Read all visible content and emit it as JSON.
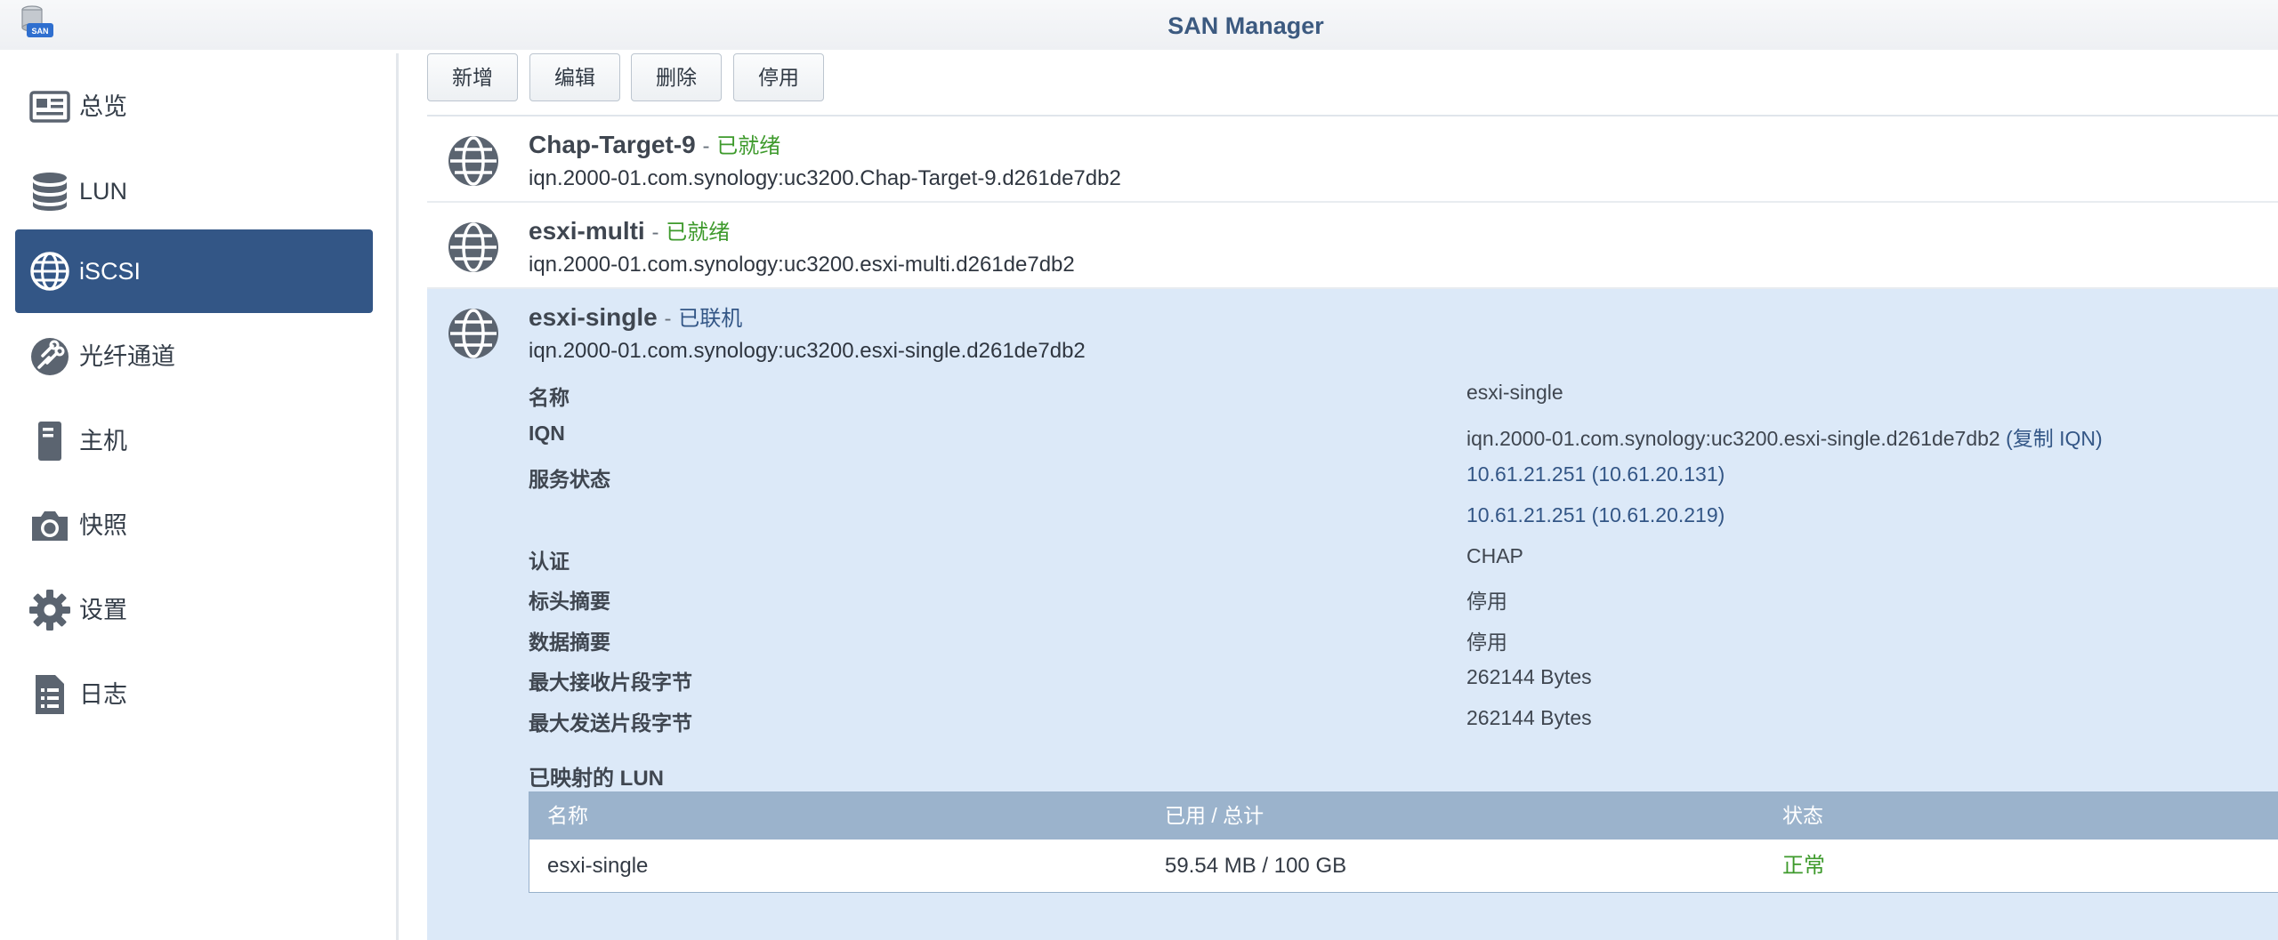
{
  "window": {
    "title": "SAN Manager",
    "logo_text": "SAN"
  },
  "sidebar": {
    "items": [
      {
        "label": "总览",
        "icon": "overview-icon",
        "active": false
      },
      {
        "label": "LUN",
        "icon": "database-icon",
        "active": false
      },
      {
        "label": "iSCSI",
        "icon": "globe-icon",
        "active": true
      },
      {
        "label": "光纤通道",
        "icon": "fibre-channel-icon",
        "active": false
      },
      {
        "label": "主机",
        "icon": "host-icon",
        "active": false
      },
      {
        "label": "快照",
        "icon": "camera-icon",
        "active": false
      },
      {
        "label": "设置",
        "icon": "gear-icon",
        "active": false
      },
      {
        "label": "日志",
        "icon": "log-icon",
        "active": false
      }
    ]
  },
  "toolbar": {
    "new_label": "新增",
    "edit_label": "编辑",
    "delete_label": "删除",
    "disable_label": "停用"
  },
  "targets": [
    {
      "name": "Chap-Target-9",
      "separator": "-",
      "status": "已就绪",
      "iqn": "iqn.2000-01.com.synology:uc3200.Chap-Target-9.d261de7db2"
    },
    {
      "name": "esxi-multi",
      "separator": "-",
      "status": "已就绪",
      "iqn": "iqn.2000-01.com.synology:uc3200.esxi-multi.d261de7db2"
    },
    {
      "name": "esxi-single",
      "separator": "-",
      "status": "已联机",
      "iqn": "iqn.2000-01.com.synology:uc3200.esxi-single.d261de7db2"
    }
  ],
  "details": {
    "name_label": "名称",
    "name_value": "esxi-single",
    "iqn_label": "IQN",
    "iqn_value": "iqn.2000-01.com.synology:uc3200.esxi-single.d261de7db2",
    "copy_iqn": "(复制 IQN)",
    "service_label": "服务状态",
    "service_values": [
      "10.61.21.251 (10.61.20.131)",
      "10.61.21.251 (10.61.20.219)"
    ],
    "auth_label": "认证",
    "auth_value": "CHAP",
    "header_digest_label": "标头摘要",
    "header_digest_value": "停用",
    "data_digest_label": "数据摘要",
    "data_digest_value": "停用",
    "max_recv_label": "最大接收片段字节",
    "max_recv_value": "262144 Bytes",
    "max_send_label": "最大发送片段字节",
    "max_send_value": "262144 Bytes"
  },
  "mapped_lun": {
    "title": "已映射的 LUN",
    "columns": [
      "名称",
      "已用 / 总计",
      "状态"
    ],
    "rows": [
      {
        "name": "esxi-single",
        "usage": "59.54 MB / 100 GB",
        "status": "正常"
      }
    ]
  },
  "colors": {
    "accent": "#335686",
    "ready": "#3e9a2c",
    "selected_bg": "#dce9f8",
    "table_header": "#9bb3cc"
  }
}
